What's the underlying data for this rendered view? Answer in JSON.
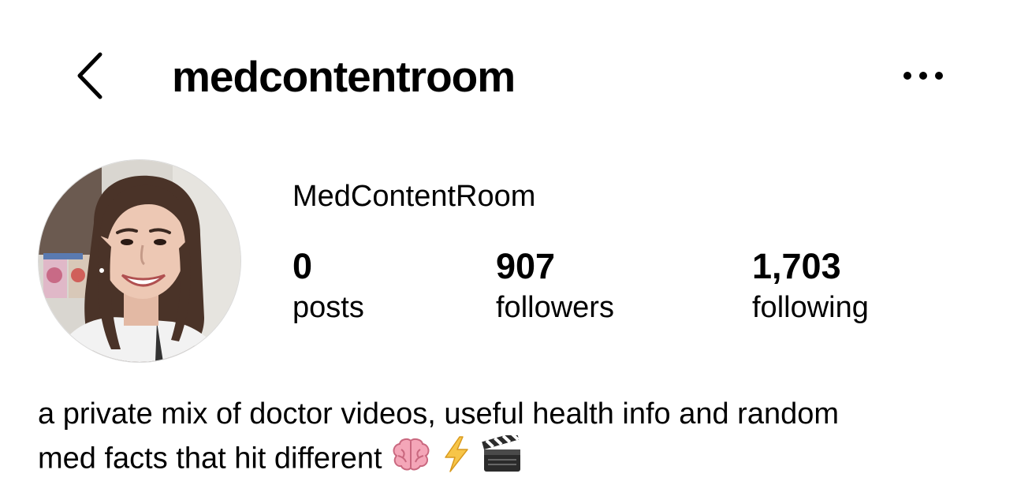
{
  "header": {
    "username": "medcontentroom",
    "back_icon": "chevron-left-icon",
    "more_icon": "more-horizontal-icon"
  },
  "profile": {
    "display_name": "MedContentRoom",
    "stats": {
      "posts": {
        "value": "0",
        "label": "posts"
      },
      "followers": {
        "value": "907",
        "label": "followers"
      },
      "following": {
        "value": "1,703",
        "label": "following"
      }
    },
    "bio": {
      "line1": "a private mix of doctor videos, useful health info and random",
      "line2": "med facts that hit different",
      "emojis": [
        "brain-emoji",
        "lightning-emoji",
        "clapperboard-emoji"
      ]
    }
  },
  "colors": {
    "text": "#000000",
    "background": "#ffffff"
  }
}
